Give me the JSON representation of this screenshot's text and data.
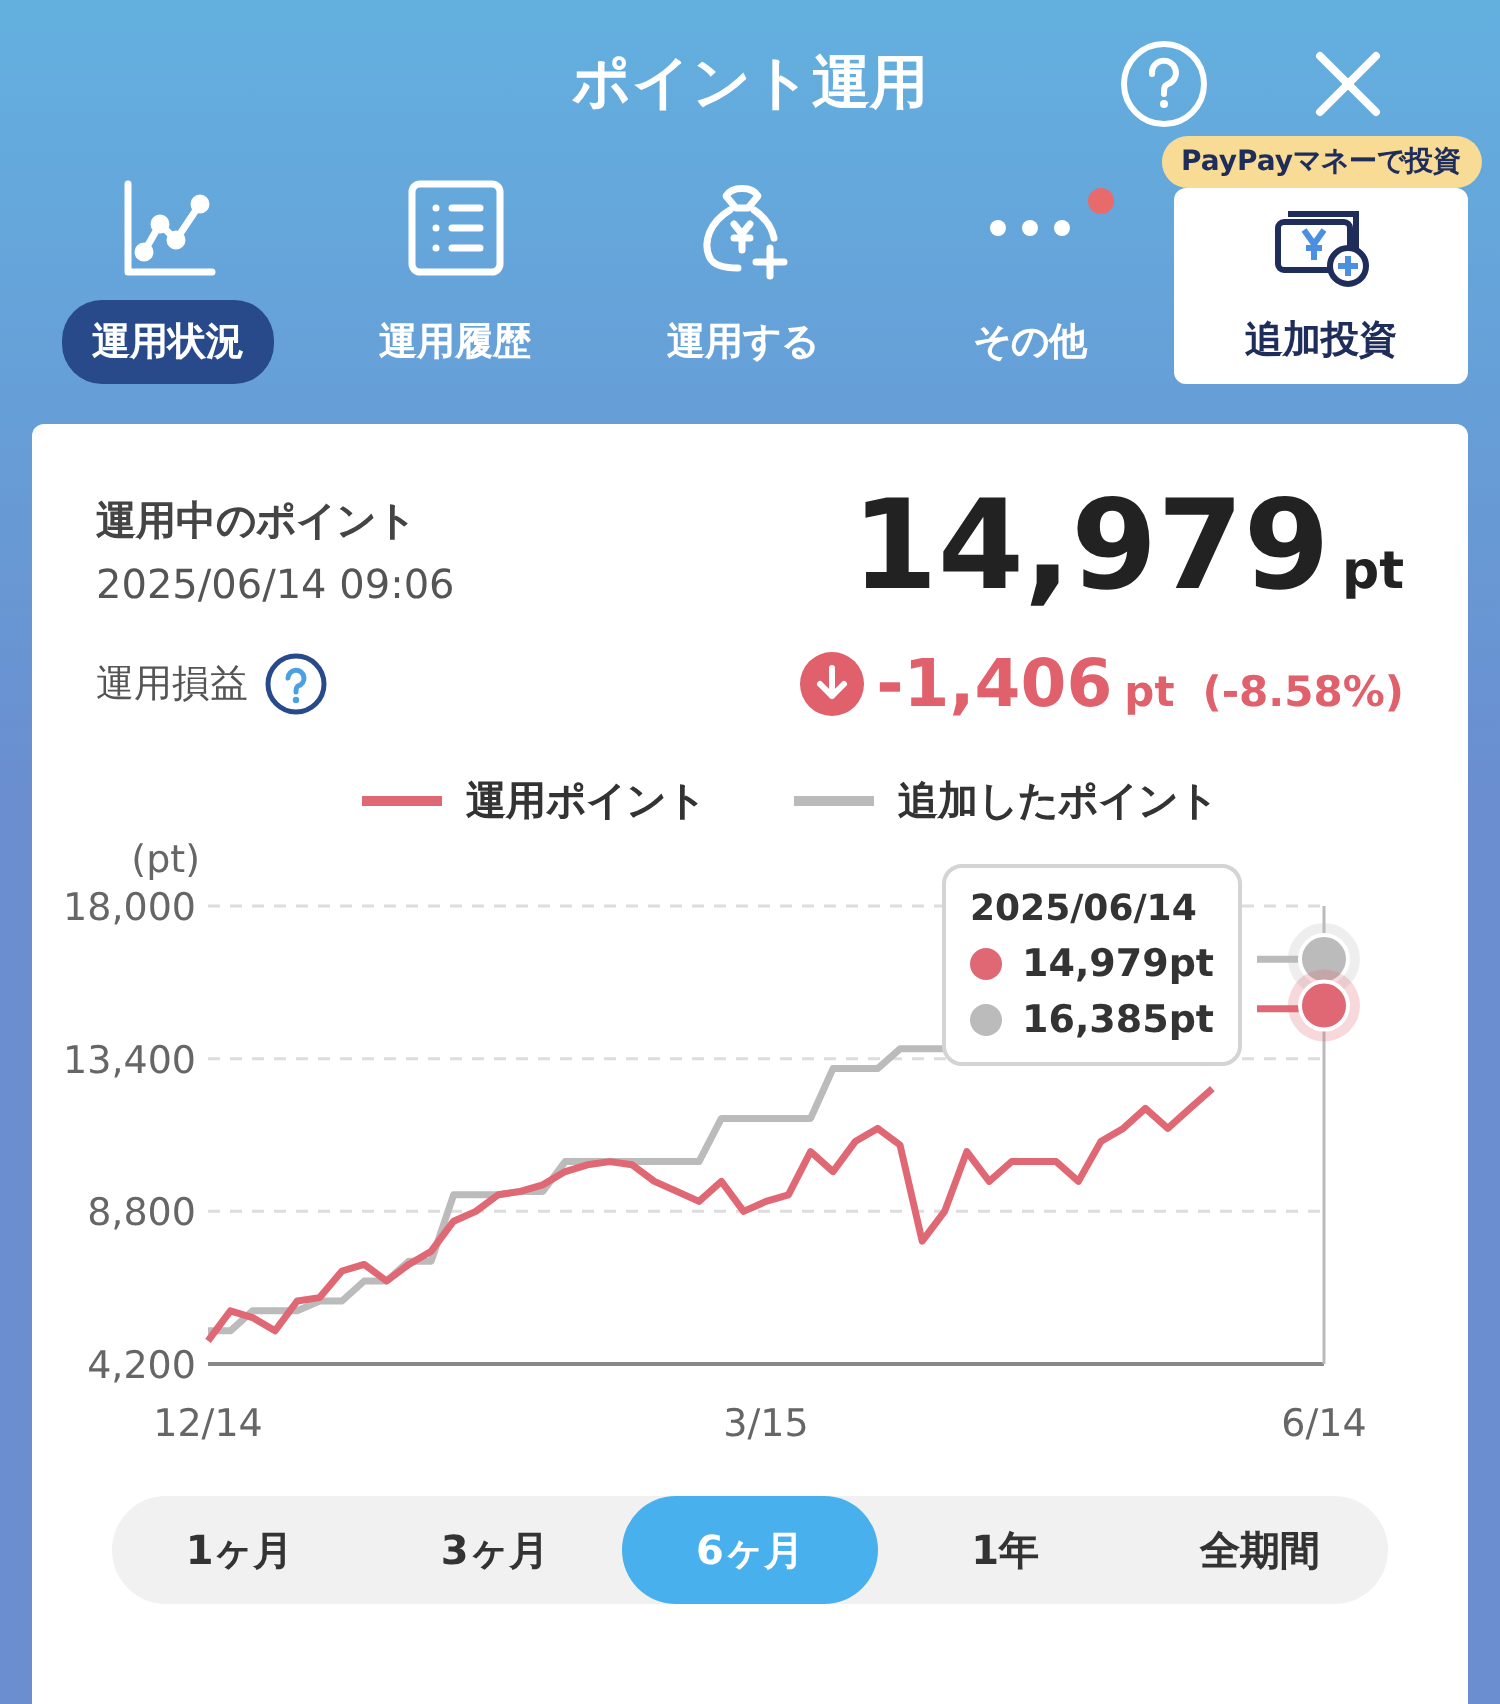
{
  "header": {
    "title": "ポイント運用"
  },
  "nav": [
    {
      "label": "運用状況",
      "selected": true,
      "dot": false,
      "kind": "tab"
    },
    {
      "label": "運用履歴",
      "selected": false,
      "dot": false,
      "kind": "tab"
    },
    {
      "label": "運用する",
      "selected": false,
      "dot": false,
      "kind": "tab"
    },
    {
      "label": "その他",
      "selected": false,
      "dot": true,
      "kind": "tab"
    },
    {
      "label": "追加投資",
      "kind": "card",
      "badge": "PayPayマネーで投資"
    }
  ],
  "summary": {
    "label": "運用中のポイント",
    "date": "2025/06/14 09:06",
    "value": "14,979",
    "unit": "pt",
    "pl_label": "運用損益",
    "pl_value": "-1,406",
    "pl_unit": "pt",
    "pl_percent": "(-8.58%)"
  },
  "chart": {
    "tooltip": {
      "date": "2025/06/14",
      "rows": [
        "14,979pt",
        "16,385pt"
      ]
    },
    "chart_data": {
      "type": "line",
      "ylabel": "(pt)",
      "categories": [
        "12/14",
        null,
        null,
        null,
        null,
        null,
        null,
        null,
        null,
        null,
        null,
        null,
        null,
        null,
        null,
        null,
        null,
        null,
        null,
        null,
        null,
        null,
        null,
        null,
        null,
        "3/15",
        null,
        null,
        null,
        null,
        null,
        null,
        null,
        null,
        null,
        null,
        null,
        null,
        null,
        null,
        null,
        null,
        null,
        null,
        null,
        null,
        null,
        null,
        null,
        null,
        "6/14"
      ],
      "series": [
        {
          "name": "運用ポイント",
          "color": "#e06874",
          "values": [
            4900,
            5800,
            5600,
            5200,
            6100,
            6200,
            7000,
            7200,
            6700,
            7200,
            7600,
            8500,
            8800,
            9300,
            9400,
            9600,
            10000,
            10200,
            10300,
            10200,
            9700,
            9400,
            9100,
            9700,
            8800,
            9100,
            9300,
            10600,
            10000,
            10900,
            11300,
            10800,
            7900,
            8800,
            10600,
            9700,
            10300,
            10300,
            10300,
            9700,
            10900,
            11300,
            11900,
            11300,
            11900,
            12500,
            null,
            14900,
            14900,
            14900,
            15000
          ]
        },
        {
          "name": "追加したポイント",
          "color": "#bbbbbb",
          "values": [
            5200,
            5200,
            5800,
            5800,
            5800,
            6100,
            6100,
            6700,
            6700,
            7300,
            7300,
            9300,
            9300,
            9300,
            9400,
            9400,
            10300,
            10300,
            10300,
            10300,
            10300,
            10300,
            10300,
            11600,
            11600,
            11600,
            11600,
            11600,
            13100,
            13100,
            13100,
            13700,
            13700,
            13700,
            null,
            null,
            null,
            null,
            null,
            null,
            null,
            null,
            null,
            null,
            null,
            null,
            null,
            16400,
            16400,
            16400,
            16400
          ]
        }
      ],
      "ylim": [
        4200,
        18000
      ],
      "yticks": [
        {
          "value": 4200,
          "label": "4,200"
        },
        {
          "value": 8800,
          "label": "8,800"
        },
        {
          "value": 13400,
          "label": "13,400"
        },
        {
          "value": 18000,
          "label": "18,000"
        }
      ]
    }
  },
  "periods": [
    {
      "label": "1ヶ月",
      "selected": false
    },
    {
      "label": "3ヶ月",
      "selected": false
    },
    {
      "label": "6ヶ月",
      "selected": true
    },
    {
      "label": "1年",
      "selected": false
    },
    {
      "label": "全期間",
      "selected": false
    }
  ]
}
